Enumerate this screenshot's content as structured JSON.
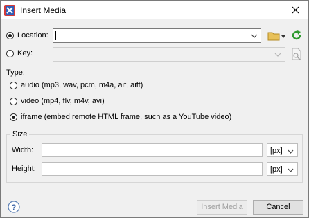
{
  "window": {
    "title": "Insert Media"
  },
  "source": {
    "location_label": "Location:",
    "location_value": "",
    "key_label": "Key:",
    "key_value": ""
  },
  "type": {
    "label": "Type:",
    "options": [
      "audio (mp3, wav, pcm, m4a, aif, aiff)",
      "video (mp4, flv, m4v, avi)",
      "iframe (embed remote HTML frame, such as a YouTube video)"
    ],
    "selected": 2
  },
  "size": {
    "group_label": "Size",
    "width_label": "Width:",
    "width_value": "",
    "width_unit": "[px]",
    "height_label": "Height:",
    "height_value": "",
    "height_unit": "[px]"
  },
  "footer": {
    "insert_label": "Insert Media",
    "cancel_label": "Cancel"
  },
  "colors": {
    "refresh_green": "#2e9a2e",
    "folder_yellow": "#e8c15a",
    "app_icon_red": "#d23a3a"
  },
  "icons": [
    "app-icon",
    "close-icon",
    "chevron-down-icon",
    "folder-icon",
    "refresh-icon",
    "key-browse-icon",
    "help-icon"
  ]
}
